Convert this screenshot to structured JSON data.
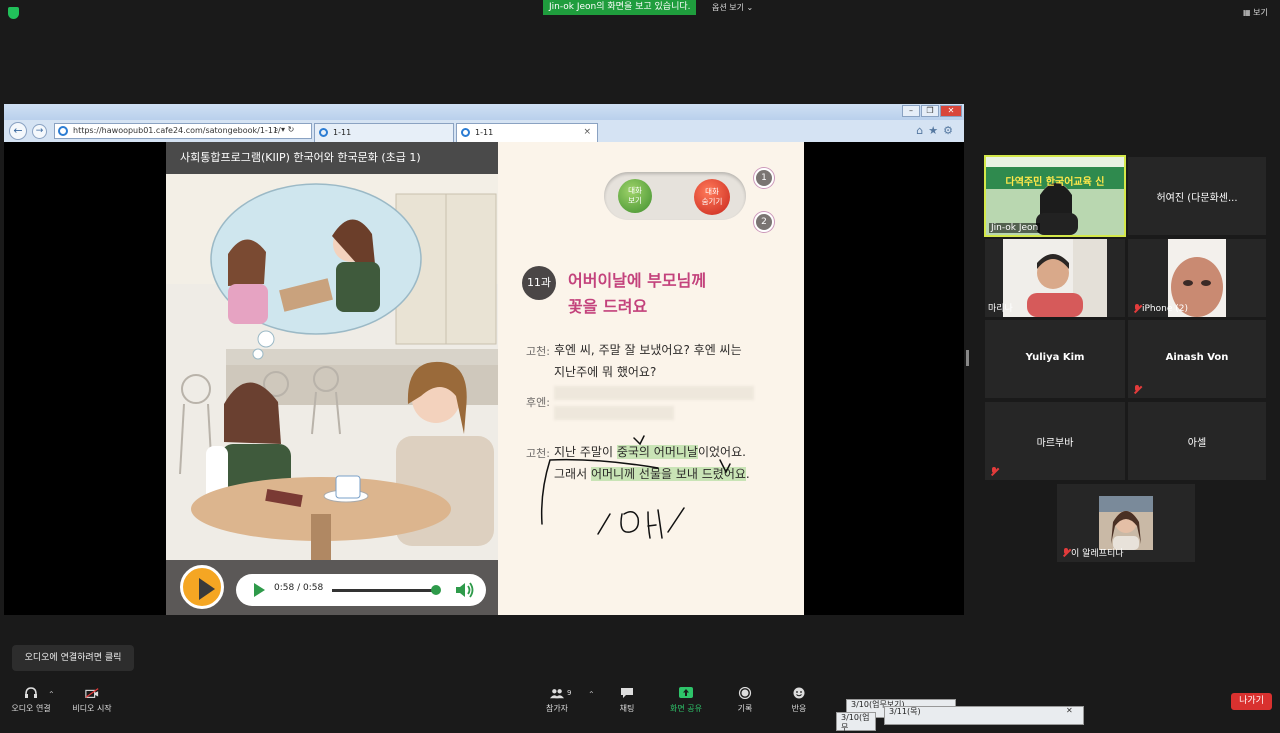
{
  "top_bar": {
    "share_banner": "Jin-ok  Jeon의 화면을 보고 있습니다.",
    "options_view": "옵션 보기 ⌄",
    "view_button": "보기"
  },
  "browser": {
    "address": "https://hawoopub01.cafe24.com/satongebook/1-11/",
    "tabs": [
      {
        "label": "1-11"
      },
      {
        "label": "1-11"
      }
    ],
    "tab_close": "×"
  },
  "book": {
    "header": "사회통합프로그램(KIIP) 한국어와 한국문화 (초급 1)",
    "audio_time": "0:58 / 0:58",
    "audio_progress": 0.96,
    "toggle_show_label": "대화\n보기",
    "toggle_hide_label": "대화\n숨기기",
    "markers": [
      "1",
      "2"
    ],
    "lesson_badge": "11과",
    "lesson_title_line1": "어버이날에 부모님께",
    "lesson_title_line2": "꽃을 드려요",
    "dialogue": [
      {
        "speaker": "고천:",
        "line1": "후엔 씨, 주말 잘 보냈어요? 후엔 씨는",
        "line2": "지난주에 뭐 했어요?"
      },
      {
        "speaker": "후엔:",
        "line1": "",
        "line2": ""
      },
      {
        "speaker": "고천:",
        "line1_pre": "지난 주말이 ",
        "line1_hl": "중국의 어머니날",
        "line1_post": "이었어요.",
        "line2_pre": "그래서 ",
        "line2_hl": "어머니께 선물을 보내 드렸어요",
        "line2_post": "."
      }
    ]
  },
  "gallery": {
    "participants": [
      {
        "name": "Jin-ok Jeon",
        "video": true,
        "active": true
      },
      {
        "name": "허여진 (다문화센...",
        "video": false
      },
      {
        "name": "마리나",
        "video": true
      },
      {
        "name": "iPhone (2)",
        "video": true,
        "muted": true
      },
      {
        "name": "Yuliya Kim",
        "video": false
      },
      {
        "name": "Ainash Von",
        "video": false,
        "muted": true
      },
      {
        "name": "마르부바",
        "video": false,
        "muted": true
      },
      {
        "name": "아셀",
        "video": false
      },
      {
        "name": "이 알레프티나",
        "video": true,
        "muted": true
      }
    ],
    "banner_text": "다역주민 한국어교육 신"
  },
  "bottom": {
    "tooltip": "오디오에 연결하려면 클릭",
    "audio": "오디오 연결",
    "video": "비디오 시작",
    "participants": "참가자",
    "participants_count": "9",
    "chat": "채팅",
    "share": "화면 공유",
    "record": "기록",
    "reactions": "반응",
    "leave": "나가기",
    "taskbar_items": [
      "3/10(업무보기)",
      "3/11(목)",
      "3/10(업무"
    ]
  },
  "colors": {
    "share_green": "#1f9d3d",
    "accent_pink": "#c3427c",
    "leave_red": "#d9312f",
    "active_speaker": "#d4e84a"
  }
}
